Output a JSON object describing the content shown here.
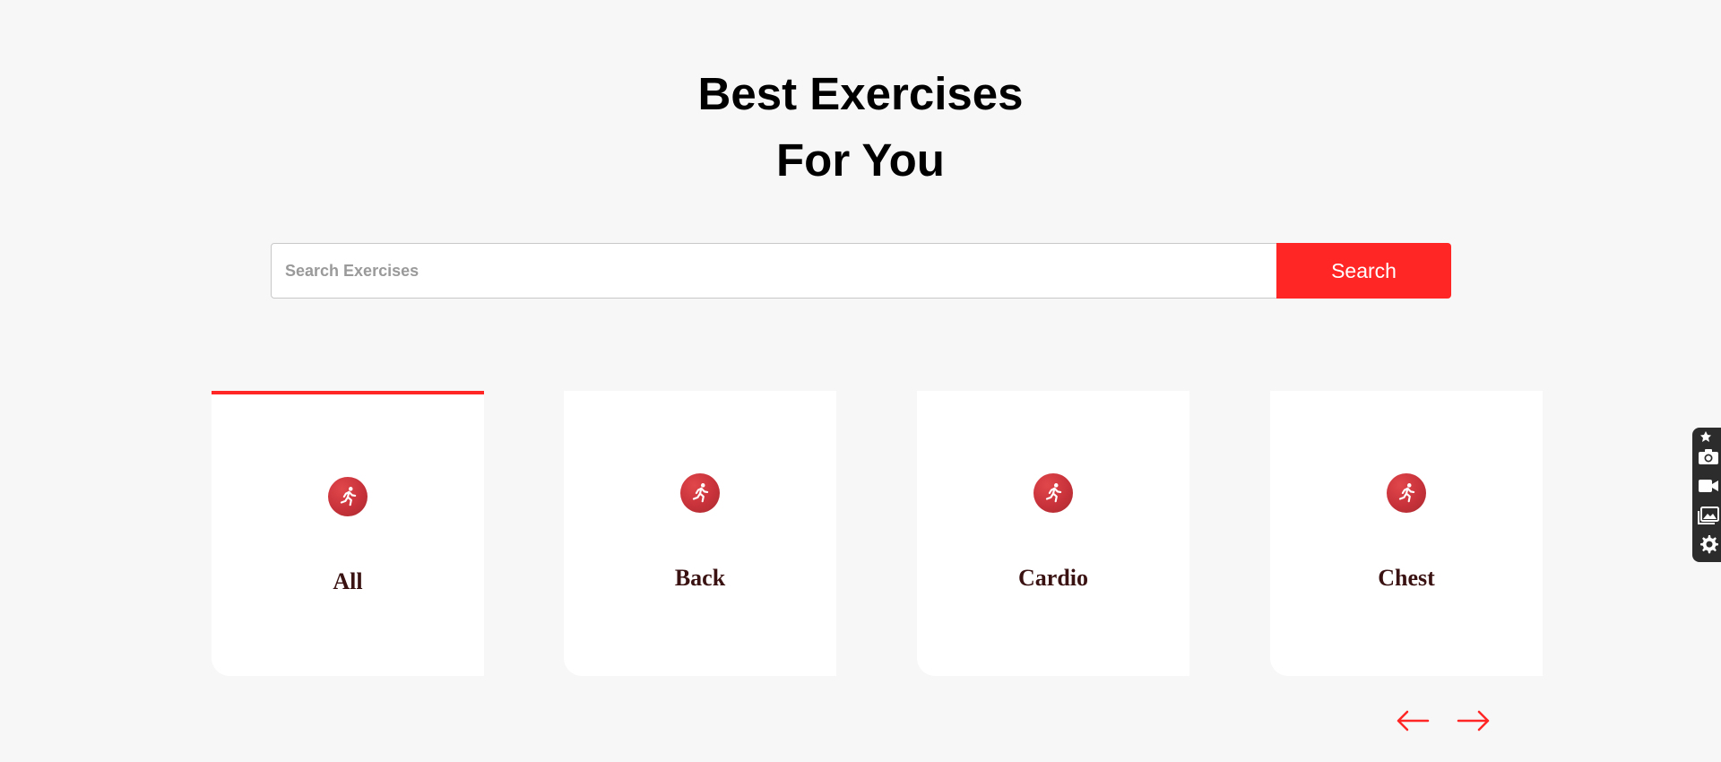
{
  "hero": {
    "title_line1": "Best Exercises",
    "title_line2": "For You"
  },
  "search": {
    "placeholder": "Search Exercises",
    "value": "",
    "button_label": "Search"
  },
  "categories": [
    {
      "label": "All",
      "icon": "running-person-icon",
      "active": true
    },
    {
      "label": "Back",
      "icon": "running-person-icon",
      "active": false
    },
    {
      "label": "Cardio",
      "icon": "running-person-icon",
      "active": false
    },
    {
      "label": "Chest",
      "icon": "running-person-icon",
      "active": false
    }
  ],
  "pagination": {
    "prev_icon": "left-arrow-icon",
    "next_icon": "right-arrow-icon"
  },
  "side_toolbar": {
    "tools": [
      "pin-icon",
      "camera-icon",
      "video-camera-icon",
      "gallery-icon",
      "gear-icon"
    ]
  },
  "colors": {
    "accent": "#ff2625",
    "background": "#f7f7f7",
    "card": "#ffffff",
    "category_text": "#3a1212",
    "icon_circle": "#c8323a"
  }
}
